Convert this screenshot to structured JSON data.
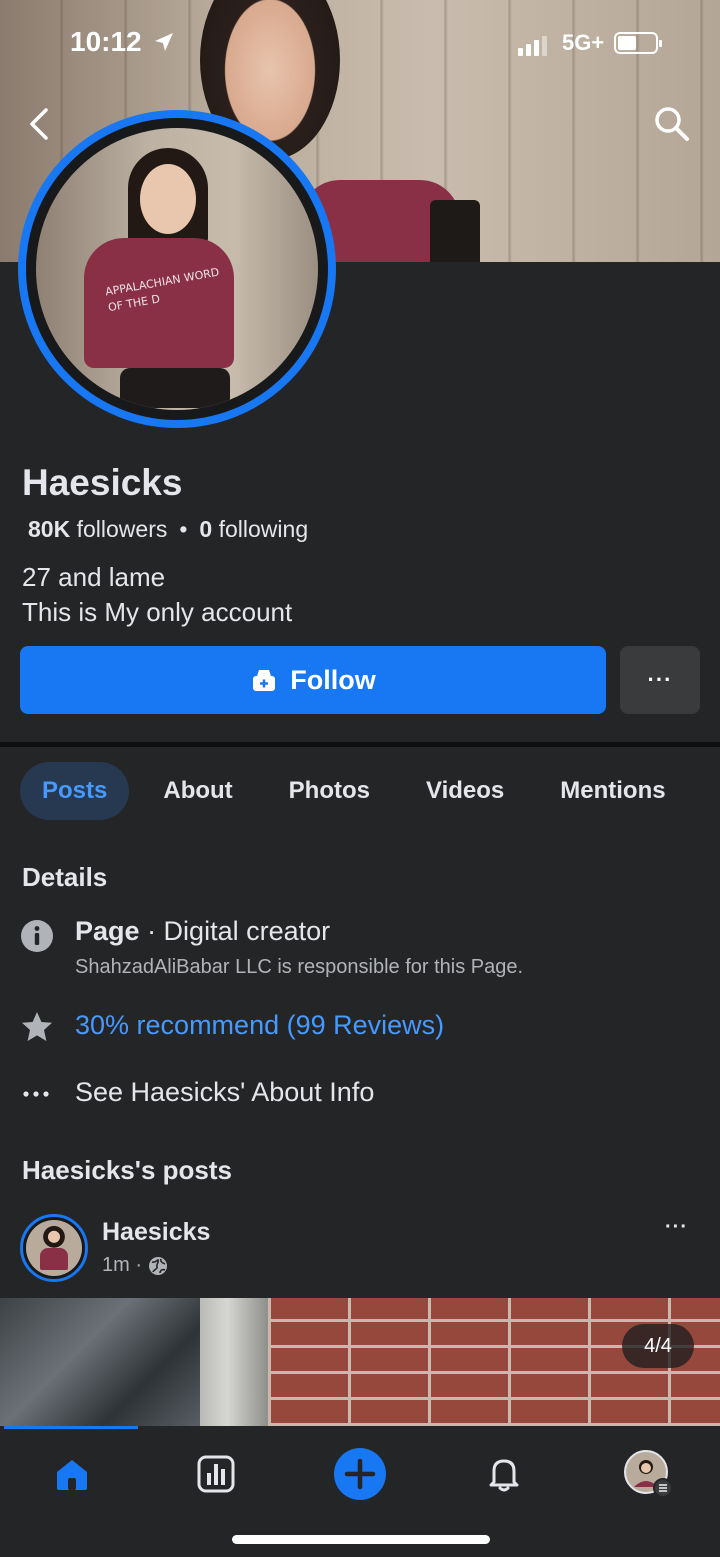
{
  "status_bar": {
    "time": "10:12",
    "network": "5G+"
  },
  "profile": {
    "name": "Haesicks",
    "followers_count": "80K",
    "followers_label": "followers",
    "following_count": "0",
    "following_label": "following",
    "bio_line1": "27 and lame",
    "bio_line2": "This is My only account",
    "avatar_shirt_text": "APPALACHIAN WORD OF THE D"
  },
  "actions": {
    "follow_label": "Follow",
    "more_label": "···"
  },
  "tabs": [
    {
      "label": "Posts",
      "active": true
    },
    {
      "label": "About",
      "active": false
    },
    {
      "label": "Photos",
      "active": false
    },
    {
      "label": "Videos",
      "active": false
    },
    {
      "label": "Mentions",
      "active": false
    }
  ],
  "details": {
    "heading": "Details",
    "category_label": "Page",
    "category_value": "· Digital creator",
    "responsibility_note": "ShahzadAliBabar LLC is responsible for this Page.",
    "recommend_text": "30% recommend (99 Reviews)",
    "about_link": "See Haesicks' About Info"
  },
  "posts_section": {
    "heading": "Haesicks's posts",
    "post": {
      "author": "Haesicks",
      "time": "1m ·",
      "more_label": "···",
      "image_counter": "4/4"
    }
  },
  "colors": {
    "accent": "#1877f2",
    "background": "#242526",
    "link": "#4599ff"
  },
  "icons": {
    "back": "chevron-left-icon",
    "search": "search-icon",
    "follow": "follow-icon",
    "info": "info-icon",
    "star": "star-icon",
    "more": "ellipsis-icon",
    "globe": "globe-icon",
    "home": "home-icon",
    "dashboard": "dashboard-icon",
    "create": "plus-icon",
    "notifications": "bell-icon",
    "profile": "avatar-icon"
  }
}
